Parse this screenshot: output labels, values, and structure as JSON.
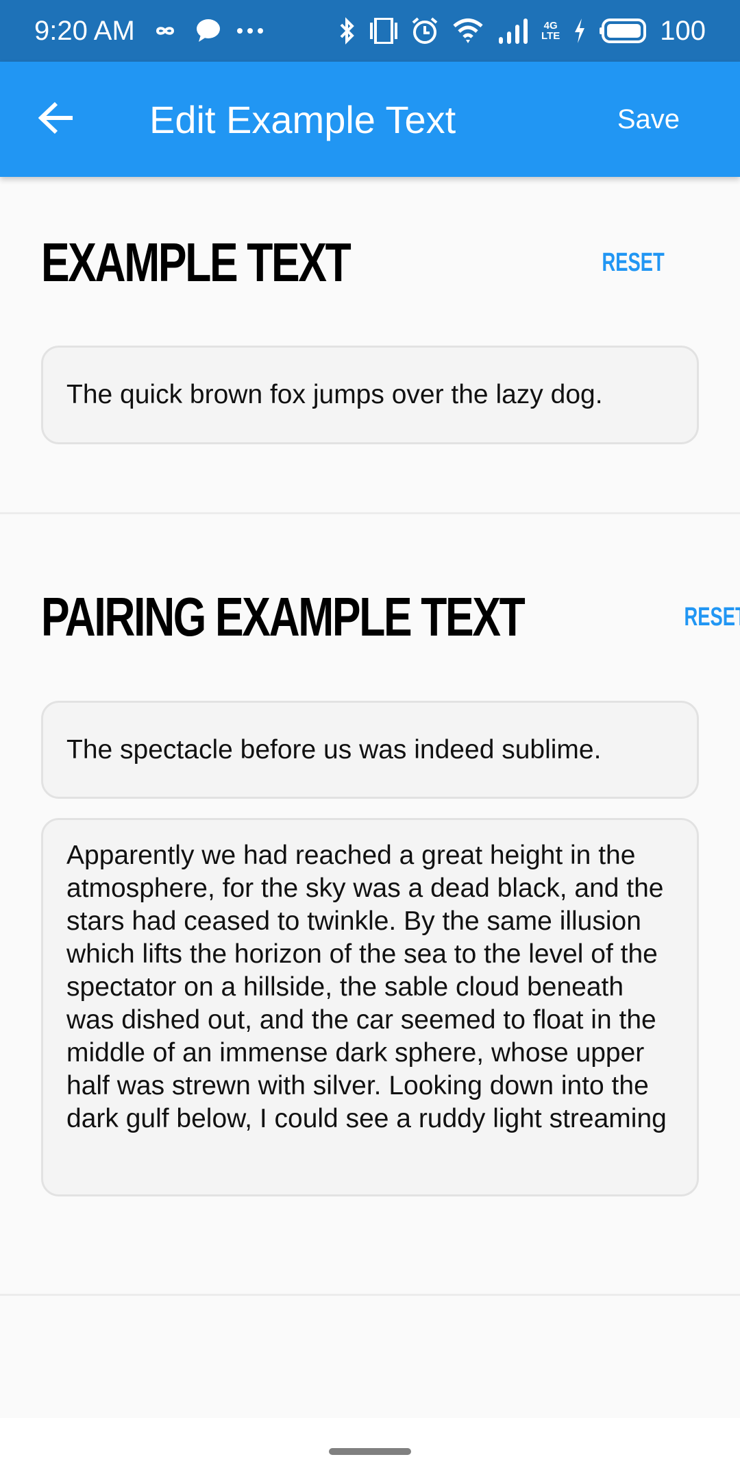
{
  "status_bar": {
    "time": "9:20 AM",
    "left_icons": [
      "infinity-icon",
      "chat-bubble-icon",
      "more-dots-icon"
    ],
    "right_icons": [
      "bluetooth-icon",
      "vibrate-icon",
      "alarm-icon",
      "wifi-icon",
      "signal-icon",
      "network-4g-lte-icon",
      "charging-icon",
      "battery-icon"
    ],
    "network_top": "4G",
    "network_bottom": "LTE",
    "battery": "100"
  },
  "app_bar": {
    "back_icon": "arrow-back-icon",
    "title": "Edit Example Text",
    "save_label": "Save",
    "color": "#2196f3"
  },
  "sections": [
    {
      "title": "EXAMPLE TEXT",
      "reset_label": "RESET",
      "fields": [
        {
          "value": "The quick brown fox jumps over the lazy dog."
        }
      ]
    },
    {
      "title": "PAIRING EXAMPLE TEXT",
      "reset_label": "RESET",
      "fields": [
        {
          "value": "The spectacle before us was indeed sublime."
        },
        {
          "value": "Apparently we had reached a great height in the atmosphere, for the sky was a dead black, and the stars had ceased to twinkle. By the same illusion which lifts the horizon of the sea to the level of the spectator on a hillside, the sable cloud beneath was dished out, and the car seemed to float in the middle of an immense dark sphere, whose upper half was strewn with silver. Looking down into the dark gulf below, I could see a ruddy light streaming"
        }
      ]
    }
  ],
  "colors": {
    "status_bar": "#1e72b8",
    "accent": "#2196f3",
    "background": "#fafafa",
    "field_background": "#f4f4f4",
    "field_border": "#e2e2e2"
  }
}
